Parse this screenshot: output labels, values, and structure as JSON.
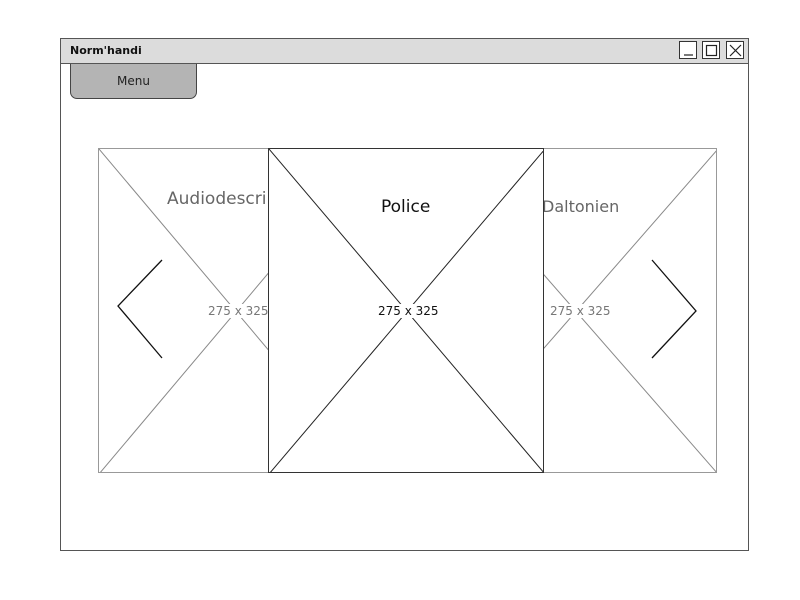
{
  "window": {
    "title": "Norm'handi"
  },
  "menu": {
    "label": "Menu"
  },
  "carousel": {
    "cards": [
      {
        "title": "Audiodescrip",
        "dimensions": "275 x 325"
      },
      {
        "title": "Police",
        "dimensions": "275 x 325"
      },
      {
        "title": "Daltonien",
        "dimensions": "275 x 325"
      }
    ]
  },
  "colors": {
    "titlebar": "#dcdcdc",
    "menu_button": "#b4b4b4"
  }
}
